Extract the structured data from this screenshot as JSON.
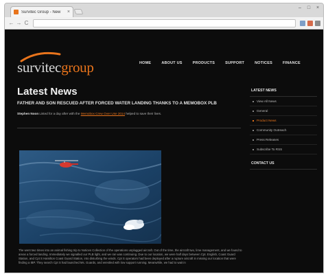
{
  "browser": {
    "tab_title": "Survitec Group - New",
    "tab_close": "×",
    "window_controls": [
      "–",
      "□",
      "×"
    ],
    "url": "",
    "nav": {
      "back": "←",
      "forward": "→",
      "reload": "C"
    },
    "toolbar_icon_colors": [
      "#7d9ec7",
      "#d46a4a",
      "#8a8a8a"
    ]
  },
  "logo": {
    "part1": "survitec",
    "part2": "group",
    "accent_color": "#e8741c"
  },
  "nav": [
    "HOME",
    "ABOUT US",
    "PRODUCTS",
    "SUPPORT",
    "NOTICES",
    "FINANCE"
  ],
  "article": {
    "heading": "Latest News",
    "headline": "Father and son rescued after forced water landing thanks to a memobox PLB",
    "lead_prefix": "Stephen Noon",
    "lead_text": "Listed for a day after with the",
    "lead_link": "Memobox Crew Over Use 2014",
    "lead_suffix": "helped to save their lives.",
    "body": "The went two times into an animal fishing trip to Notices Collection of the operations unplugged aircraft. Out of the time, the aircraft two, lime management, and we found to areas a forced landing. Immediately we signalled our PLB light, and we ran was continuing. Due to our location, we were half days between Cpt. English, Coast Guard Station, and Cpt S Hamilton Coast Guard Station, into disturbing the winds. Cpt S operators had been deployed after a rupture aircraft in missing our location that were finding a IBP. They search Cpt S had launched Ms. Guards, and wrestled with low support running. Meanwhile, we had to wait in"
  },
  "sidebar": {
    "heading": "LATEST NEWS",
    "items": [
      "View All News",
      "General",
      "Product News",
      "Community Outreach",
      "Press Releases",
      "Subscribe To RSS"
    ],
    "active_index": 2,
    "contact_heading": "CONTACT US"
  }
}
